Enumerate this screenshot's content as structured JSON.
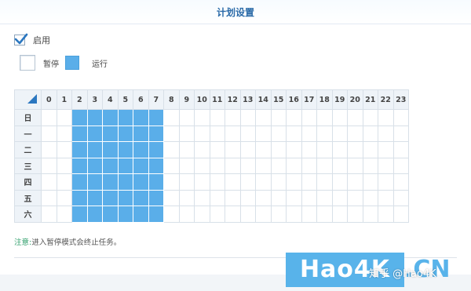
{
  "window": {
    "title": "计划设置"
  },
  "enable": {
    "label": "启用",
    "checked": true
  },
  "legend": {
    "pause_label": "暂停",
    "run_label": "运行",
    "run_color": "#5aaee9"
  },
  "schedule": {
    "hours": [
      "0",
      "1",
      "2",
      "3",
      "4",
      "5",
      "6",
      "7",
      "8",
      "9",
      "10",
      "11",
      "12",
      "13",
      "14",
      "15",
      "16",
      "17",
      "18",
      "19",
      "20",
      "21",
      "22",
      "23"
    ],
    "days": [
      "日",
      "一",
      "二",
      "三",
      "四",
      "五",
      "六"
    ],
    "running_hours": [
      2,
      3,
      4,
      5,
      6,
      7
    ]
  },
  "note": {
    "label": "注意:",
    "text": "进入暂停模式会终止任务。"
  },
  "watermark": {
    "brand": "Hao4K",
    "suffix": ".CN",
    "zhihu": "知乎 @Hao4K"
  }
}
